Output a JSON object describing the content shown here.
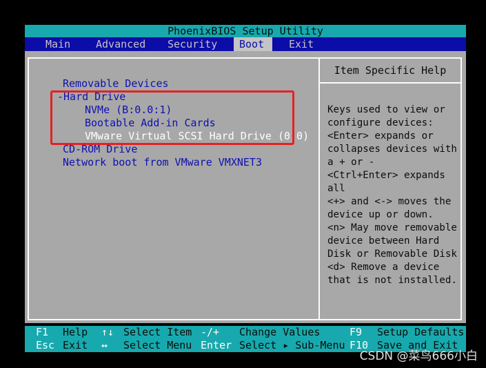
{
  "title": "PhoenixBIOS Setup Utility",
  "menu": {
    "items": [
      {
        "label": "Main",
        "active": false
      },
      {
        "label": "Advanced",
        "active": false
      },
      {
        "label": "Security",
        "active": false
      },
      {
        "label": "Boot",
        "active": true
      },
      {
        "label": "Exit",
        "active": false
      }
    ]
  },
  "boot_list": [
    {
      "label": "Removable Devices"
    },
    {
      "label": "-Hard Drive"
    },
    {
      "label": "NVMe (B:0.0:1)"
    },
    {
      "label": "Bootable Add-in Cards"
    },
    {
      "label": "VMware Virtual SCSI Hard Drive (0:0)",
      "selected": true
    },
    {
      "label": "CD-ROM Drive"
    },
    {
      "label": "Network boot from VMware VMXNET3"
    }
  ],
  "help": {
    "title": "Item Specific Help",
    "lines": [
      "Keys used to view or",
      "configure devices:",
      "<Enter> expands or",
      "collapses devices with",
      "a + or -",
      "<Ctrl+Enter> expands",
      "all",
      "<+> and <-> moves the",
      "device up or down.",
      "<n> May move removable",
      "device between Hard",
      "Disk or Removable Disk",
      "<d> Remove a device",
      "that is not installed."
    ]
  },
  "status": {
    "f1_key": "F1",
    "f1_desc": "Help",
    "esc_key": "Esc",
    "esc_desc": "Exit",
    "updown_key": "↑↓",
    "updown_desc": "Select Item",
    "leftright_key": "↔",
    "leftright_desc": "Select Menu",
    "plusminus_key": "-/+",
    "plusminus_desc": "Change Values",
    "enter_key": "Enter",
    "enter_desc": "Select ▸ Sub-Menu",
    "f9_key": "F9",
    "f9_desc": "Setup Defaults",
    "f10_key": "F10",
    "f10_desc": "Save and Exit"
  },
  "watermark": "CSDN @菜鸟666小白",
  "colors": {
    "title_bg": "#17a9ad",
    "menu_bg": "#0c0ca8",
    "panel_bg": "#a8a8a8",
    "item_blue": "#1010b0",
    "highlight": "#e82020"
  }
}
